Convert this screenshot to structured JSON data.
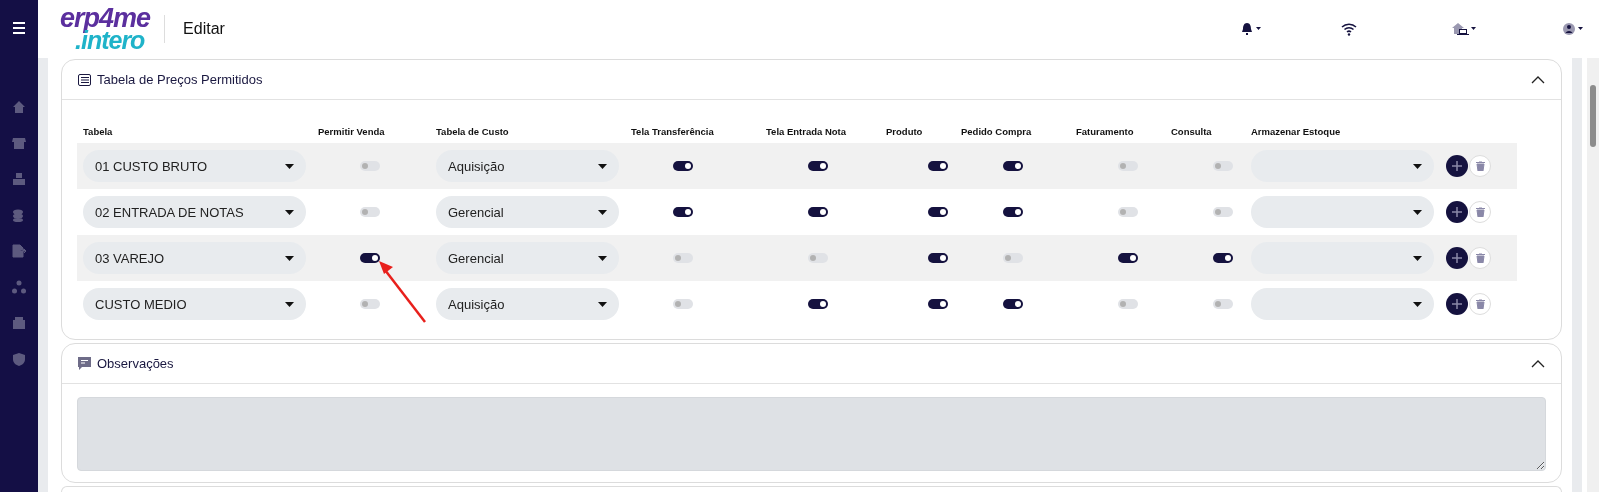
{
  "header": {
    "logo_top": "erp4me",
    "logo_bottom": ".intero",
    "title": "Editar"
  },
  "prices_card": {
    "title": "Tabela de Preços Permitidos",
    "expanded": true,
    "columns": [
      "Tabela",
      "Permitir Venda",
      "Tabela de Custo",
      "Tela Transferência",
      "Tela Entrada Nota",
      "Produto",
      "Pedido Compra",
      "Faturamento",
      "Consulta",
      "Armazenar Estoque"
    ],
    "rows": [
      {
        "tabela": "01 CUSTO BRUTO",
        "permitir_venda": false,
        "tabela_custo": "Aquisição",
        "tela_transferencia": true,
        "tela_entrada_nota": true,
        "produto": true,
        "pedido_compra": true,
        "faturamento": false,
        "consulta": false
      },
      {
        "tabela": "02 ENTRADA DE NOTAS",
        "permitir_venda": false,
        "tabela_custo": "Gerencial",
        "tela_transferencia": true,
        "tela_entrada_nota": true,
        "produto": true,
        "pedido_compra": true,
        "faturamento": false,
        "consulta": false
      },
      {
        "tabela": "03 VAREJO",
        "permitir_venda": true,
        "tabela_custo": "Gerencial",
        "tela_transferencia": false,
        "tela_entrada_nota": false,
        "produto": true,
        "pedido_compra": false,
        "faturamento": true,
        "consulta": true
      },
      {
        "tabela": "CUSTO MEDIO",
        "permitir_venda": false,
        "tabela_custo": "Aquisição",
        "tela_transferencia": false,
        "tela_entrada_nota": true,
        "produto": true,
        "pedido_compra": true,
        "faturamento": false,
        "consulta": false
      }
    ]
  },
  "notes_card": {
    "title": "Observações",
    "expanded": true
  }
}
